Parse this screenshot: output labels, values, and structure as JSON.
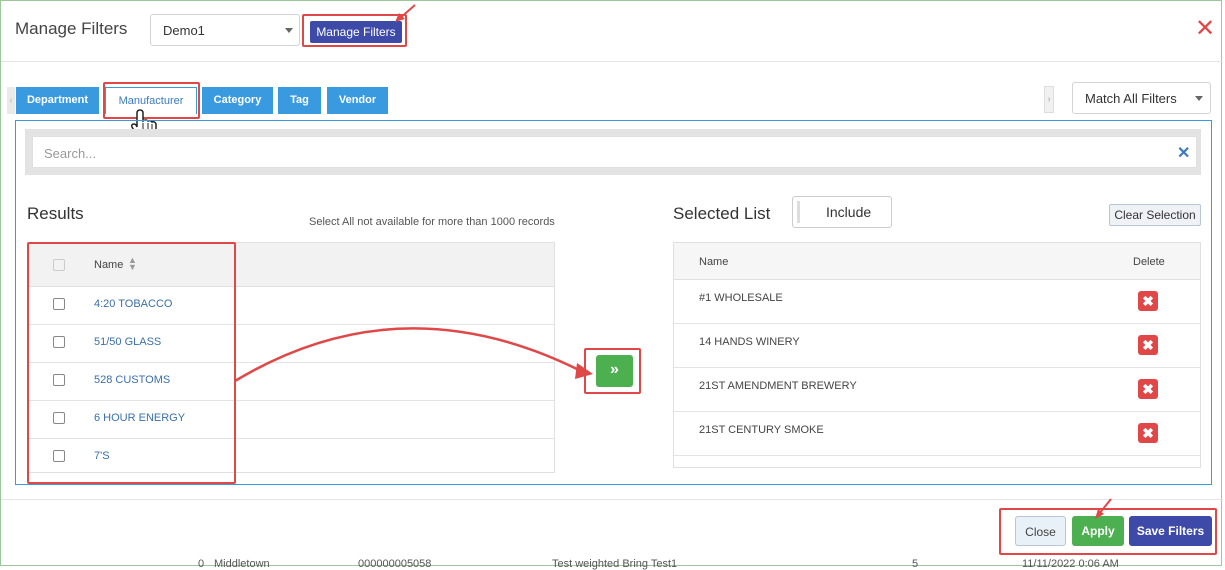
{
  "header": {
    "title": "Manage Filters",
    "preset_value": "Demo1",
    "manage_button": "Manage Filters",
    "close_symbol": "✕"
  },
  "tabs": [
    {
      "label": "Department",
      "active": false
    },
    {
      "label": "Manufacturer",
      "active": true
    },
    {
      "label": "Category",
      "active": false
    },
    {
      "label": "Tag",
      "active": false
    },
    {
      "label": "Vendor",
      "active": false
    }
  ],
  "match_select": {
    "value": "Match All Filters"
  },
  "search": {
    "placeholder": "Search...",
    "clear_symbol": "✕"
  },
  "results": {
    "title": "Results",
    "note": "Select All not available for more than 1000 records",
    "column_name": "Name",
    "rows": [
      "4:20 TOBACCO",
      "51/50 GLASS",
      "528 CUSTOMS",
      "6 HOUR ENERGY",
      "7'S"
    ]
  },
  "move_button": {
    "symbol": "»"
  },
  "selected": {
    "title": "Selected List",
    "include_label": "Include",
    "clear_label": "Clear Selection",
    "column_name": "Name",
    "column_delete": "Delete",
    "rows": [
      "#1 WHOLESALE",
      "14 HANDS WINERY",
      "21ST AMENDMENT BREWERY",
      "21ST CENTURY SMOKE"
    ],
    "delete_symbol": "✖"
  },
  "footer": {
    "close": "Close",
    "apply": "Apply",
    "save": "Save Filters"
  },
  "background_row": [
    "0",
    "Middletown",
    "000000005058",
    "Test weighted Bring Test1",
    "5",
    "11/11/2022 0:06 AM"
  ],
  "colors": {
    "tab_blue": "#3a9ae0",
    "manage_button": "#3d4aa8",
    "apply_green": "#4caf50",
    "delete_red": "#e04848",
    "annotation_red": "#e04848"
  }
}
